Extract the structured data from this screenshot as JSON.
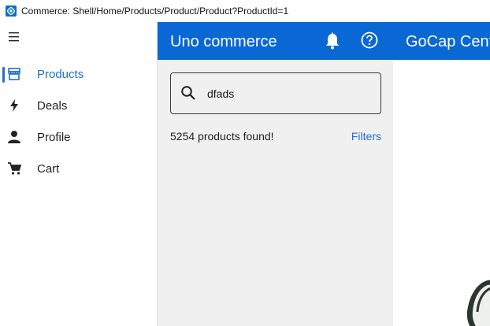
{
  "window": {
    "title": "Commerce: Shell/Home/Products/Product/Product?ProductId=1"
  },
  "sidebar": {
    "menu_icon": "hamburger-icon",
    "items": [
      {
        "label": "Products",
        "icon": "store-icon",
        "active": true
      },
      {
        "label": "Deals",
        "icon": "lightning-icon",
        "active": false
      },
      {
        "label": "Profile",
        "icon": "person-icon",
        "active": false
      },
      {
        "label": "Cart",
        "icon": "cart-icon",
        "active": false
      }
    ]
  },
  "products_panel": {
    "title": "Uno commerce",
    "search": {
      "value": "dfads"
    },
    "results_text": "5254 products found!",
    "filters_label": "Filters"
  },
  "detail_panel": {
    "title": "GoCap Cent"
  },
  "colors": {
    "accent": "#0a68d4",
    "link": "#1f6fd0",
    "panel_bg": "#f0f0f0"
  }
}
